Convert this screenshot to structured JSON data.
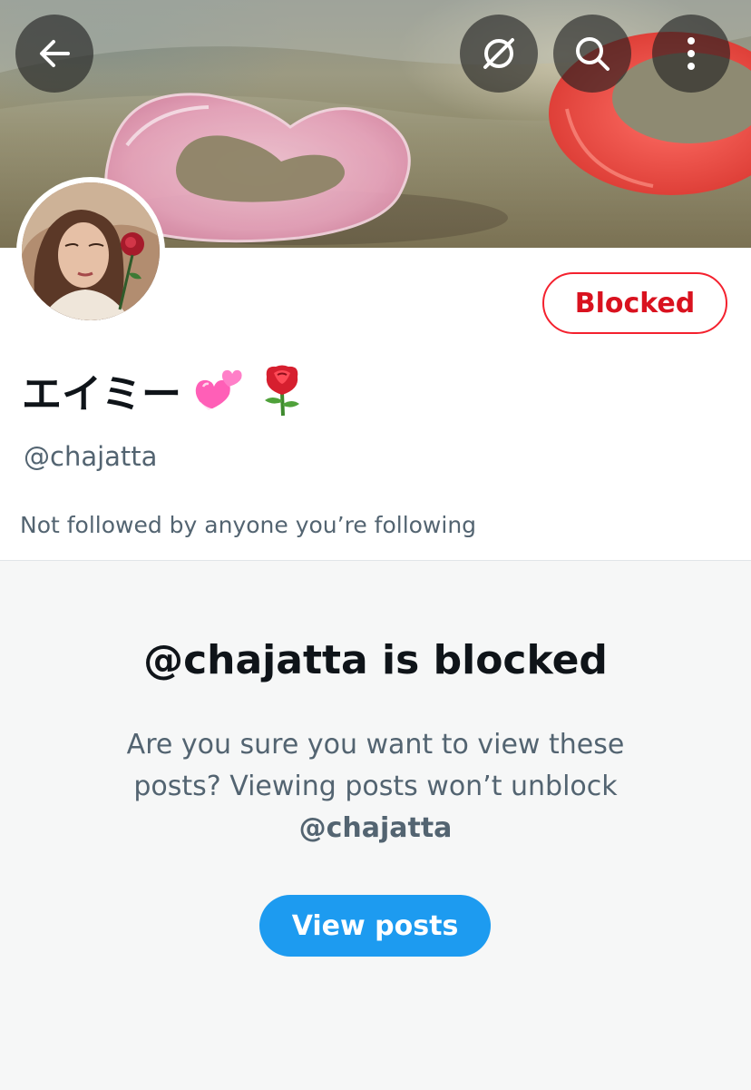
{
  "header": {
    "back_icon": "arrow-left-icon",
    "grok_icon": "grok-icon",
    "search_icon": "search-icon",
    "more_icon": "more-vertical-icon"
  },
  "profile": {
    "display_name": "エイミー",
    "name_emojis": [
      "revolving-hearts-emoji",
      "rose-emoji"
    ],
    "handle": "@chajatta",
    "followed_by": "Not followed by anyone you’re following",
    "blocked_label": "Blocked"
  },
  "blocked_notice": {
    "title": "@chajatta is blocked",
    "description": "Are you sure you want to view these posts? Viewing posts won’t unblock",
    "description_handle": "@chajatta",
    "view_posts_label": "View posts"
  },
  "colors": {
    "accent_blue": "#1d9bf0",
    "blocked_red": "#f4212e",
    "text_primary": "#0f1419",
    "text_secondary": "#536471",
    "section_background": "#f6f7f7"
  }
}
